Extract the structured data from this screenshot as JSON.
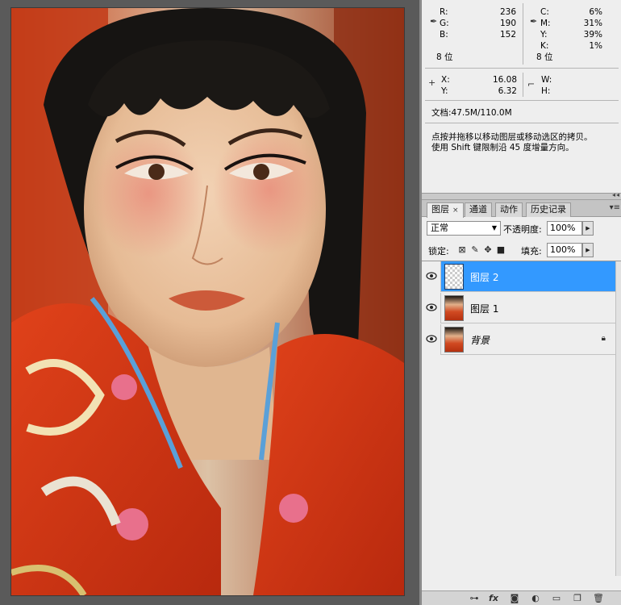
{
  "info": {
    "rgb": [
      {
        "label": "R:",
        "value": "236"
      },
      {
        "label": "G:",
        "value": "190"
      },
      {
        "label": "B:",
        "value": "152"
      }
    ],
    "rgb_depth": "8 位",
    "cmyk": [
      {
        "label": "C:",
        "value": "6%"
      },
      {
        "label": "M:",
        "value": "31%"
      },
      {
        "label": "Y:",
        "value": "39%"
      },
      {
        "label": "K:",
        "value": "1%"
      }
    ],
    "cmyk_depth": "8 位",
    "x_label": "X:",
    "x_value": "16.08",
    "y_label": "Y:",
    "y_value": "6.32",
    "w_label": "W:",
    "h_label": "H:",
    "doc_size": "文档:47.5M/110.0M",
    "hint_line1": "点按并拖移以移动图层或移动选区的拷贝。",
    "hint_line2": "使用 Shift 键限制沿 45 度增量方向。"
  },
  "layers_panel": {
    "tabs": [
      {
        "label": "图层",
        "active": true
      },
      {
        "label": "通道",
        "active": false
      },
      {
        "label": "动作",
        "active": false
      },
      {
        "label": "历史记录",
        "active": false
      }
    ],
    "tab_close": "×",
    "blend_mode": "正常",
    "opacity_label": "不透明度:",
    "opacity_value": "100%",
    "lock_label": "锁定:",
    "fill_label": "填充:",
    "fill_value": "100%",
    "layers": [
      {
        "name": "图层 2",
        "selected": true,
        "thumb": "transparent"
      },
      {
        "name": "图层 1",
        "selected": false,
        "thumb": "photo"
      },
      {
        "name": "背景",
        "selected": false,
        "thumb": "photo",
        "locked": true
      }
    ]
  },
  "bottom_icons": [
    "link-icon",
    "fx-icon",
    "mask-icon",
    "adjustment-icon",
    "group-folder-icon",
    "new-layer-icon",
    "trash-icon"
  ],
  "bottom_fx_label": "fx"
}
